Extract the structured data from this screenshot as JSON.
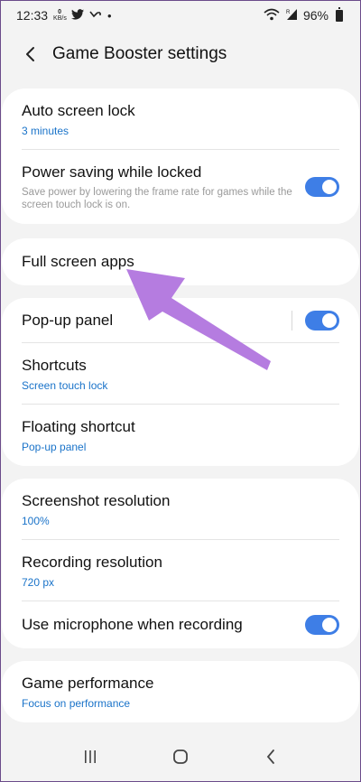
{
  "status_bar": {
    "time": "12:33",
    "kbs_value": "0",
    "kbs_unit": "KB/s",
    "dot": "•",
    "battery": "96%"
  },
  "header": {
    "title": "Game Booster settings"
  },
  "card1": {
    "auto_lock": {
      "title": "Auto screen lock",
      "value": "3 minutes"
    },
    "power_saving": {
      "title": "Power saving while locked",
      "desc": "Save power by lowering the frame rate for games while the screen touch lock is on.",
      "enabled": true
    }
  },
  "card2": {
    "full_screen": {
      "title": "Full screen apps"
    }
  },
  "card3": {
    "popup_panel": {
      "title": "Pop-up panel",
      "enabled": true
    },
    "shortcuts": {
      "title": "Shortcuts",
      "value": "Screen touch lock"
    },
    "floating": {
      "title": "Floating shortcut",
      "value": "Pop-up panel"
    }
  },
  "card4": {
    "screenshot": {
      "title": "Screenshot resolution",
      "value": "100%"
    },
    "recording": {
      "title": "Recording resolution",
      "value": "720 px"
    },
    "microphone": {
      "title": "Use microphone when recording",
      "enabled": true
    }
  },
  "card5": {
    "performance": {
      "title": "Game performance",
      "value": "Focus on performance"
    }
  },
  "colors": {
    "accent": "#3e7ee6",
    "link": "#1a73c9",
    "annotation_arrow": "#b57ce0"
  }
}
